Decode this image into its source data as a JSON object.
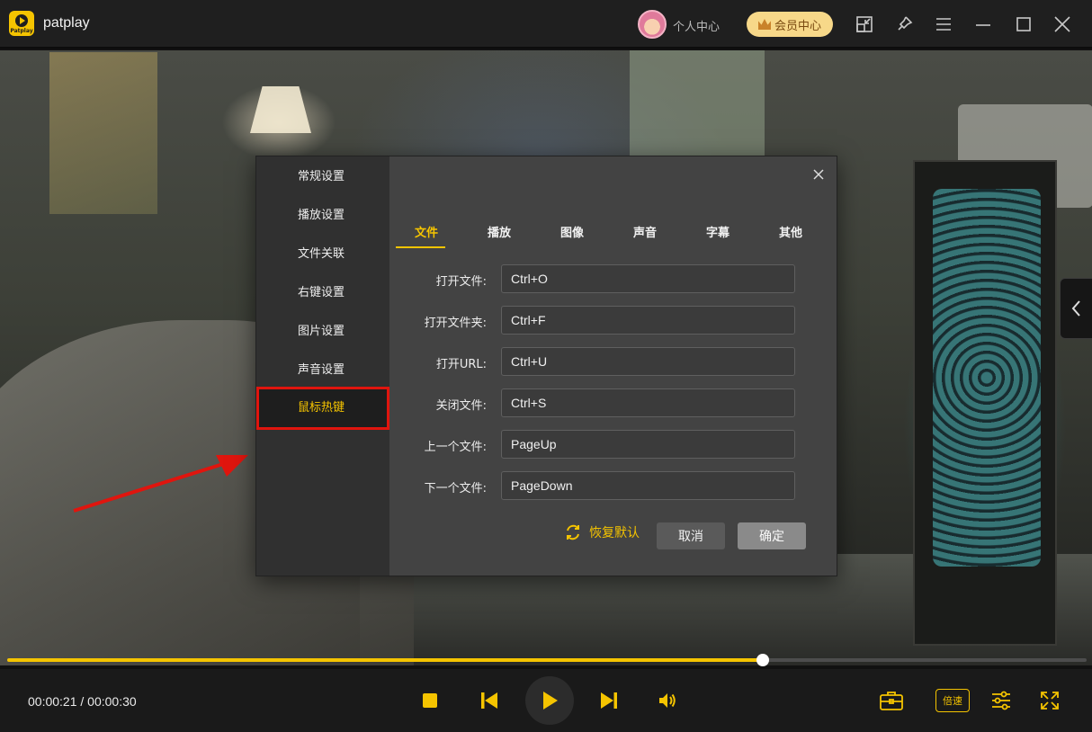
{
  "app": {
    "name": "patplay",
    "logo_text": "Patplay",
    "user_center_label": "个人中心",
    "vip_label": "会员中心"
  },
  "icons": {
    "titlebar": [
      "avatar",
      "crown-icon",
      "mini-mode-icon",
      "pin-icon",
      "menu-icon",
      "maximize-icon",
      "close-icon"
    ],
    "player": [
      "stop-icon",
      "previous-icon",
      "play-icon",
      "next-icon",
      "volume-icon",
      "toolbox-icon",
      "equalizer-icon",
      "fullscreen-icon",
      "chevron-left-icon"
    ]
  },
  "player": {
    "time_text": "00:00:21 / 00:00:30",
    "progress_fraction": 0.7,
    "speed_label": "倍速"
  },
  "dialog": {
    "nav": [
      {
        "label": "常规设置",
        "active": false
      },
      {
        "label": "播放设置",
        "active": false
      },
      {
        "label": "文件关联",
        "active": false
      },
      {
        "label": "右键设置",
        "active": false
      },
      {
        "label": "图片设置",
        "active": false
      },
      {
        "label": "声音设置",
        "active": false
      },
      {
        "label": "鼠标热键",
        "active": true
      }
    ],
    "tabs": [
      {
        "label": "文件",
        "active": true
      },
      {
        "label": "播放",
        "active": false
      },
      {
        "label": "图像",
        "active": false
      },
      {
        "label": "声音",
        "active": false
      },
      {
        "label": "字幕",
        "active": false
      },
      {
        "label": "其他",
        "active": false
      }
    ],
    "hotkeys": [
      {
        "label": "打开文件:",
        "value": "Ctrl+O"
      },
      {
        "label": "打开文件夹:",
        "value": "Ctrl+F"
      },
      {
        "label": "打开URL:",
        "value": "Ctrl+U"
      },
      {
        "label": "关闭文件:",
        "value": "Ctrl+S"
      },
      {
        "label": "上一个文件:",
        "value": "PageUp"
      },
      {
        "label": "下一个文件:",
        "value": "PageDown"
      }
    ],
    "restore_label": "恢复默认",
    "cancel_label": "取消",
    "ok_label": "确定"
  },
  "colors": {
    "accent": "#f5c400",
    "highlight_box": "#e0150e",
    "annotation_arrow": "#e0150e"
  }
}
